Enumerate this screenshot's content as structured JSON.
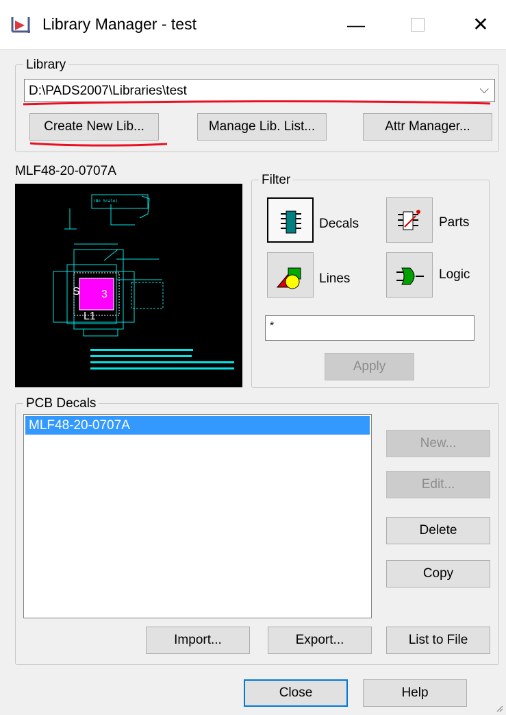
{
  "window": {
    "title": "Library Manager - test",
    "app_icon": "pads-logo-icon",
    "minimize": "—",
    "close": "✕"
  },
  "library": {
    "group_label": "Library",
    "selected_path": "D:\\PADS2007\\Libraries\\test",
    "create_new_lib": "Create New Lib...",
    "manage_lib_list": "Manage Lib. List...",
    "attr_manager": "Attr Manager..."
  },
  "preview": {
    "label": "MLF48-20-0707A",
    "art_labels": [
      "(No Scale)",
      "S",
      "3",
      "L1"
    ]
  },
  "filter": {
    "group_label": "Filter",
    "decals": "Decals",
    "parts": "Parts",
    "lines": "Lines",
    "logic": "Logic",
    "input_value": "*",
    "apply": "Apply",
    "pressed": "decals"
  },
  "pcb_decals": {
    "group_label": "PCB Decals",
    "items": [
      "MLF48-20-0707A"
    ],
    "selected_index": 0,
    "new": "New...",
    "edit": "Edit...",
    "delete": "Delete",
    "copy": "Copy",
    "import": "Import...",
    "export": "Export...",
    "list_to_file": "List to File"
  },
  "footer": {
    "close": "Close",
    "help": "Help"
  },
  "colors": {
    "selection": "#3399ff",
    "focus_border": "#0078d7",
    "annotation_red": "#e81123",
    "preview_bg": "#000000",
    "cyan": "#00e5e5",
    "magenta": "#ff00ff"
  }
}
